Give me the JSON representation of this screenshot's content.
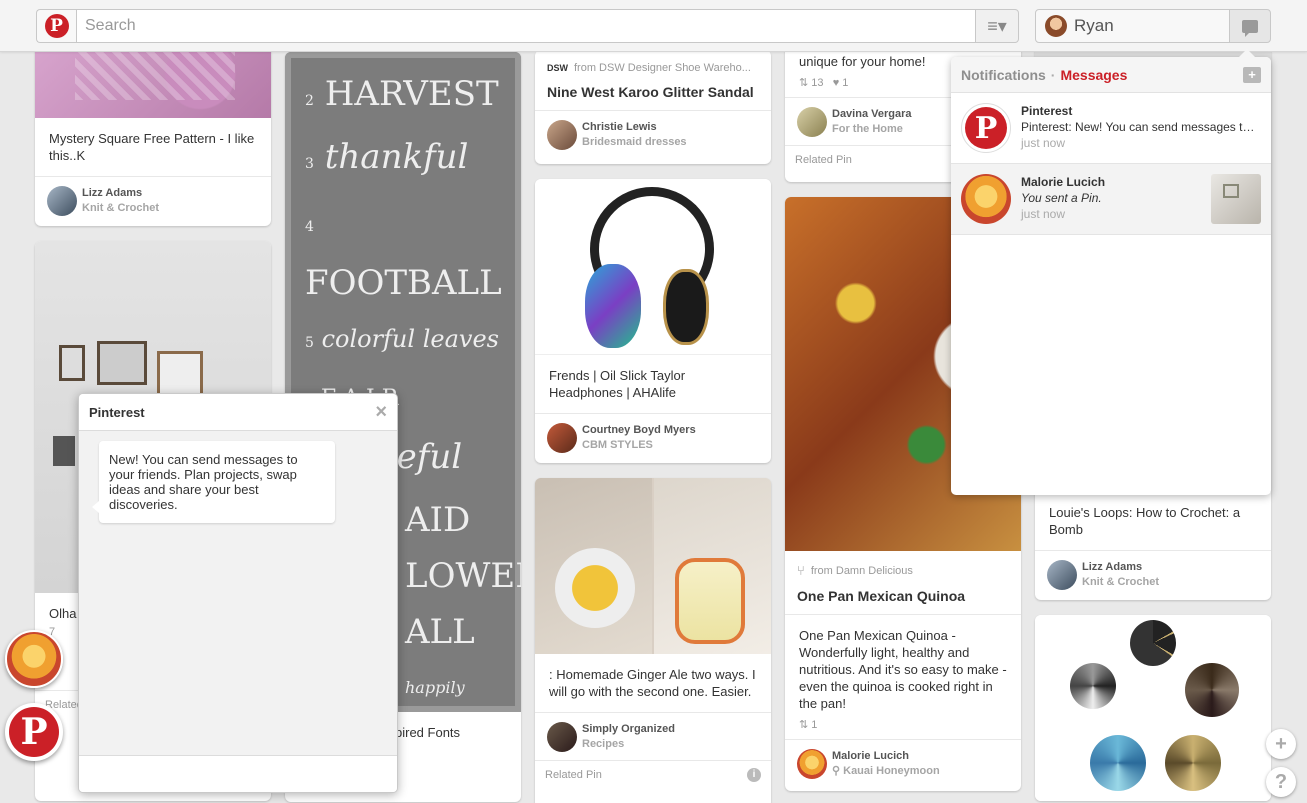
{
  "header": {
    "logo_letter": "P",
    "search_placeholder": "Search",
    "menu_icon": "≡▾",
    "user_name": "Ryan"
  },
  "notifications": {
    "tab_notifications": "Notifications",
    "separator": "·",
    "tab_messages": "Messages",
    "compose_icon": "+",
    "items": [
      {
        "name": "Pinterest",
        "text": "Pinterest: New! You can send messages to your friends.",
        "time": "just now"
      },
      {
        "name": "Malorie Lucich",
        "text": "You sent a Pin.",
        "time": "just now"
      }
    ]
  },
  "dialog": {
    "title": "Pinterest",
    "close_icon": "×",
    "message": "New! You can send messages to your friends. Plan projects, swap ideas and share your best discoveries."
  },
  "pins": {
    "col1_pin1": {
      "desc": "Mystery Square Free Pattern - I like this..K",
      "user": "Lizz Adams",
      "board": "Knit & Crochet"
    },
    "col1_pin2": {
      "desc": "Olha assi Cho m",
      "stats": "7",
      "related": "Related"
    },
    "col2_pin1": {
      "chalk": [
        {
          "num": "2",
          "word": "HARVEST"
        },
        {
          "num": "3",
          "word": "thankful"
        },
        {
          "num": "4",
          "word": "FOOTBALL"
        },
        {
          "num": "5",
          "word": "colorful leaves"
        },
        {
          "num": "6",
          "word": "F A I R"
        },
        {
          "num": "7",
          "word": "grateful"
        },
        {
          "num": "",
          "word": "AID"
        },
        {
          "num": "",
          "word": "LOWER"
        },
        {
          "num": "",
          "word": "ALL"
        },
        {
          "num": "",
          "word": "happily"
        }
      ],
      "desc": "pired Fonts"
    },
    "col3_pin1": {
      "source": "from DSW Designer Shoe Wareho...",
      "source_logo": "DSW",
      "title": "Nine West Karoo Glitter Sandal",
      "user": "Christie Lewis",
      "board": "Bridesmaid dresses"
    },
    "col3_pin2": {
      "desc": "Frends | Oil Slick Taylor Headphones | AHAlife",
      "user": "Courtney Boyd Myers",
      "board": "CBM STYLES"
    },
    "col3_pin3": {
      "desc": ": Homemade Ginger Ale two ways. I will go with the second one. Easier.",
      "user": "Simply Organized",
      "board": "Recipes",
      "related": "Related Pin",
      "info_icon": "i"
    },
    "col4_pin1": {
      "desc": "unique for your home!",
      "repins": "13",
      "likes": "1",
      "user": "Davina Vergara",
      "board": "For the Home",
      "related": "Related Pin"
    },
    "col4_pin2": {
      "source": "from Damn Delicious",
      "title": "One Pan Mexican Quinoa",
      "desc": "One Pan Mexican Quinoa - Wonderfully light, healthy and nutritious. And it's so easy to make - even the quinoa is cooked right in the pan!",
      "repins": "1",
      "user": "Malorie Lucich",
      "board": "Kauai Honeymoon"
    },
    "col5_pin1": {
      "desc": "Louie's Loops: How to Crochet: a Bomb",
      "user": "Lizz Adams",
      "board": "Knit & Crochet"
    }
  },
  "controls": {
    "add_icon": "+",
    "help_icon": "?"
  },
  "colors": {
    "brand_red": "#cb2027",
    "background": "#e9e9e9"
  }
}
